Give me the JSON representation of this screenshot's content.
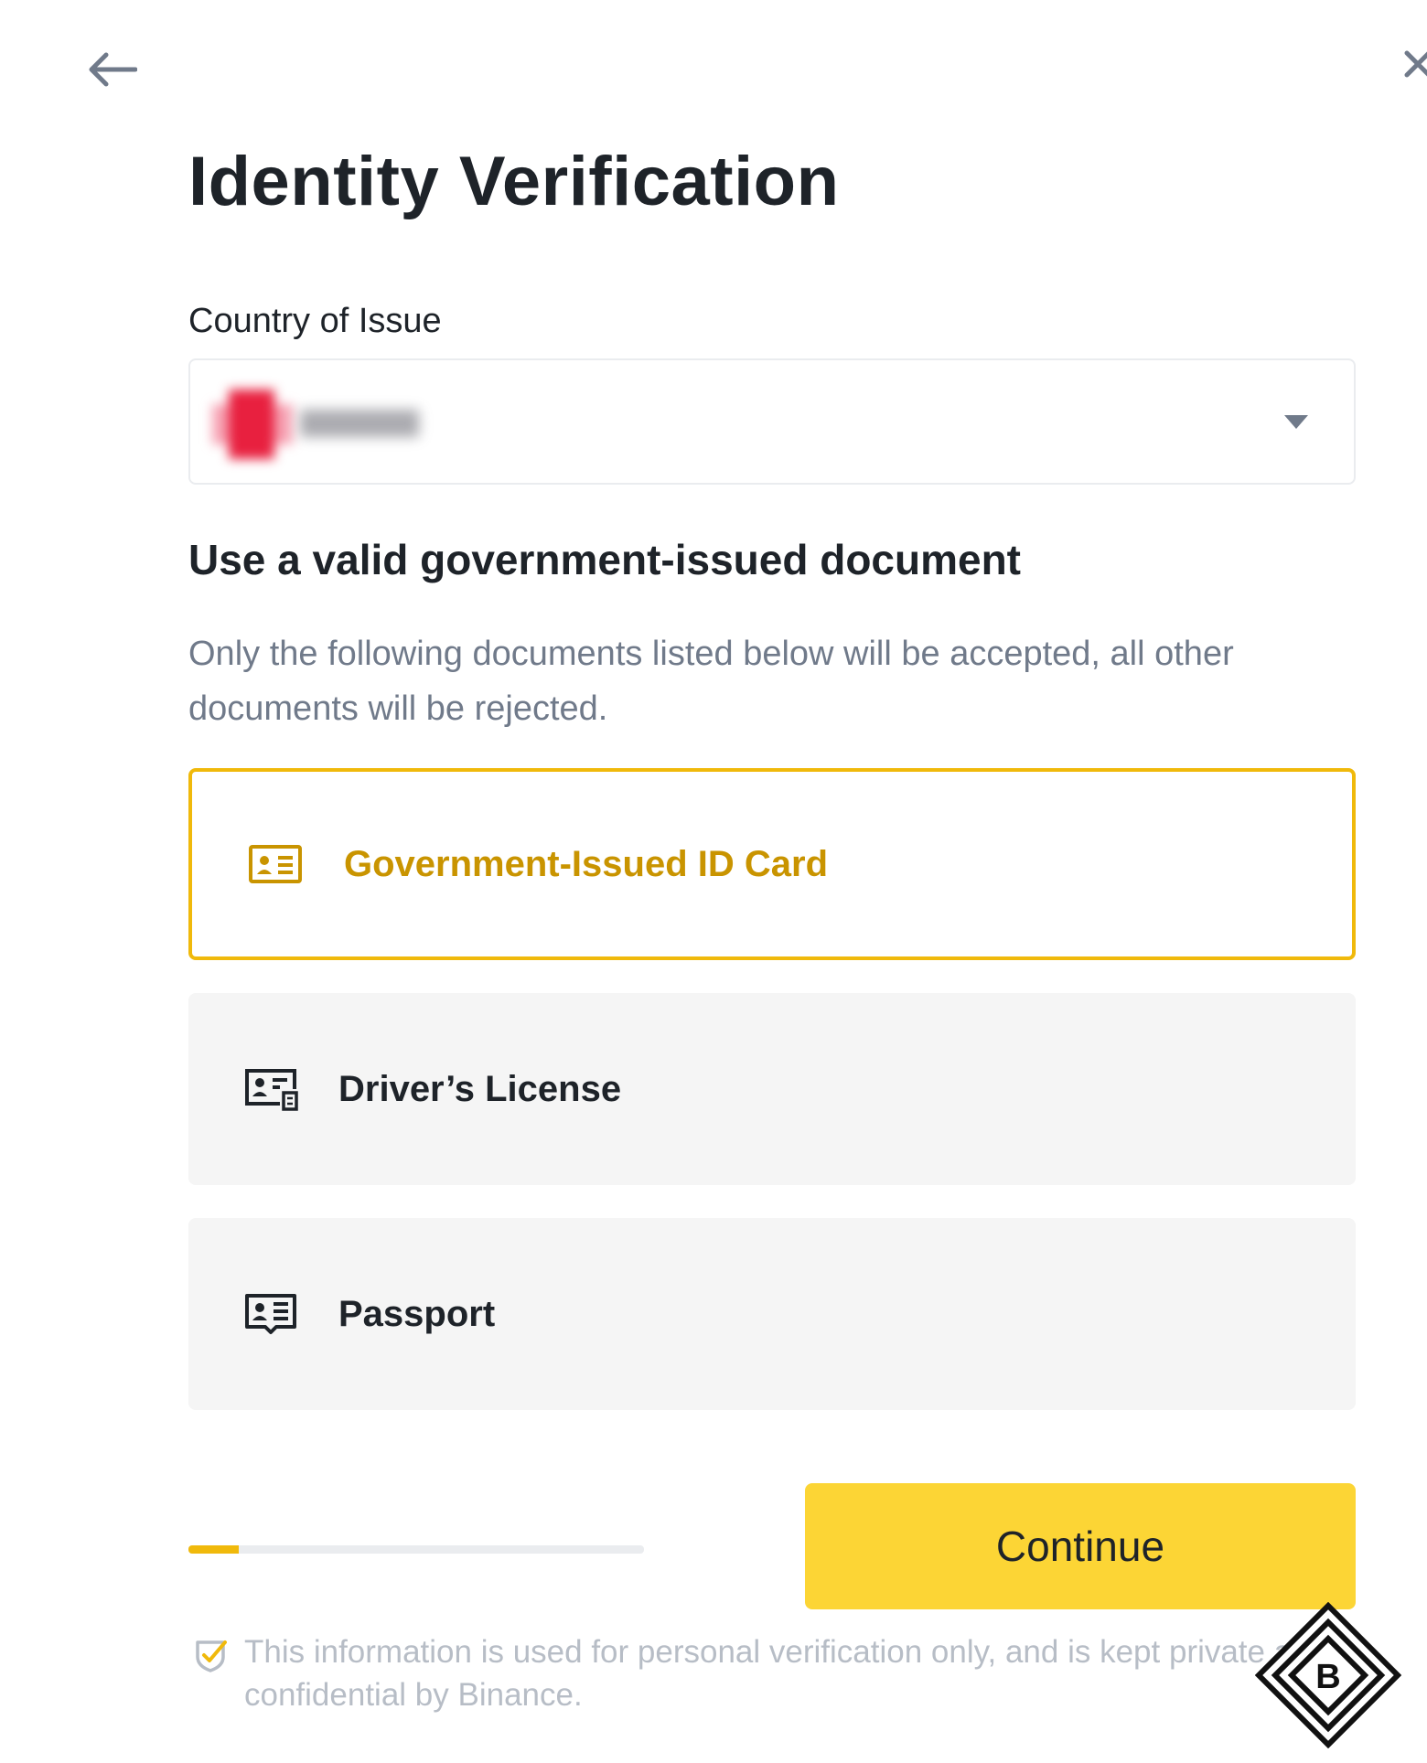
{
  "header": {
    "back_icon": "arrow-left-icon",
    "close_icon": "close-icon",
    "title": "Identity Verification"
  },
  "country": {
    "label": "Country of Issue",
    "flag_icon": "flag-icon",
    "dropdown_icon": "caret-down-icon"
  },
  "documents": {
    "heading": "Use a valid government-issued document",
    "description": "Only the following documents listed below will be accepted, all other documents will be rejected.",
    "options": [
      {
        "label": "Government-Issued ID Card",
        "icon": "id-card-icon",
        "selected": true
      },
      {
        "label": "Driver’s License",
        "icon": "drivers-license-icon",
        "selected": false
      },
      {
        "label": "Passport",
        "icon": "passport-icon",
        "selected": false
      }
    ]
  },
  "footer": {
    "progress": 0.11,
    "continue_label": "Continue",
    "notice_icon": "shield-check-icon",
    "notice": "This information is used for personal verification only, and is kept private and confidential by Binance.",
    "watermark_icon": "binance-logo-icon",
    "watermark_letter": "B"
  },
  "colors": {
    "accent": "#f0b90b",
    "accent_text": "#c99400",
    "button": "#fcd535",
    "text": "#1e2329",
    "muted": "#707a8a",
    "option_bg": "#f5f5f5"
  }
}
